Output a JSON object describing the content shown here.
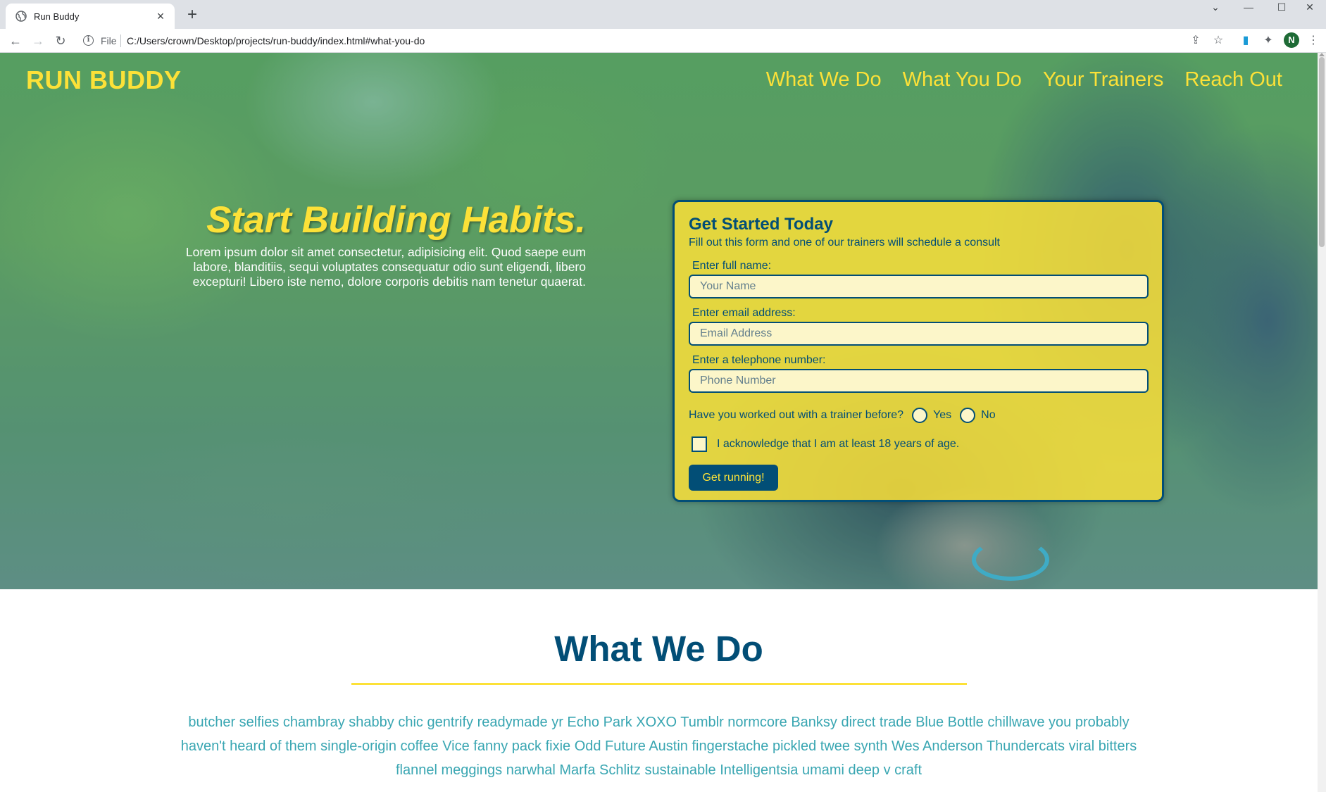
{
  "browser": {
    "tab_title": "Run Buddy",
    "new_tab_label": "+",
    "file_label": "File",
    "url": "C:/Users/crown/Desktop/projects/run-buddy/index.html#what-you-do",
    "profile_initial": "N"
  },
  "header": {
    "brand": "RUN BUDDY",
    "nav": [
      "What We Do",
      "What You Do",
      "Your Trainers",
      "Reach Out"
    ]
  },
  "hero": {
    "title": "Start Building Habits.",
    "text": "Lorem ipsum dolor sit amet consectetur, adipisicing elit. Quod saepe eum labore, blanditiis, sequi voluptates consequatur odio sunt eligendi, libero excepturi! Libero iste nemo, dolore corporis debitis nam tenetur quaerat."
  },
  "form": {
    "title": "Get Started Today",
    "subtitle": "Fill out this form and one of our trainers will schedule a consult",
    "name_label": "Enter full name:",
    "name_placeholder": "Your Name",
    "email_label": "Enter email address:",
    "email_placeholder": "Email Address",
    "phone_label": "Enter a telephone number:",
    "phone_placeholder": "Phone Number",
    "trainer_question": "Have you worked out with a trainer before?",
    "yes_label": "Yes",
    "no_label": "No",
    "age_ack": "I acknowledge that I am at least 18 years of age.",
    "submit_label": "Get running!"
  },
  "what_we_do": {
    "title": "What We Do",
    "text": "butcher selfies chambray shabby chic gentrify readymade yr Echo Park XOXO Tumblr normcore Banksy direct trade Blue Bottle chillwave you probably haven't heard of them single-origin coffee Vice fanny pack fixie Odd Future Austin fingerstache pickled twee synth Wes Anderson Thundercats viral bitters flannel meggings narwhal Marfa Schlitz sustainable Intelligentsia umami deep v craft"
  },
  "colors": {
    "brand_yellow": "#fce138",
    "brand_blue": "#024e76",
    "text_teal": "#39a6b2"
  }
}
